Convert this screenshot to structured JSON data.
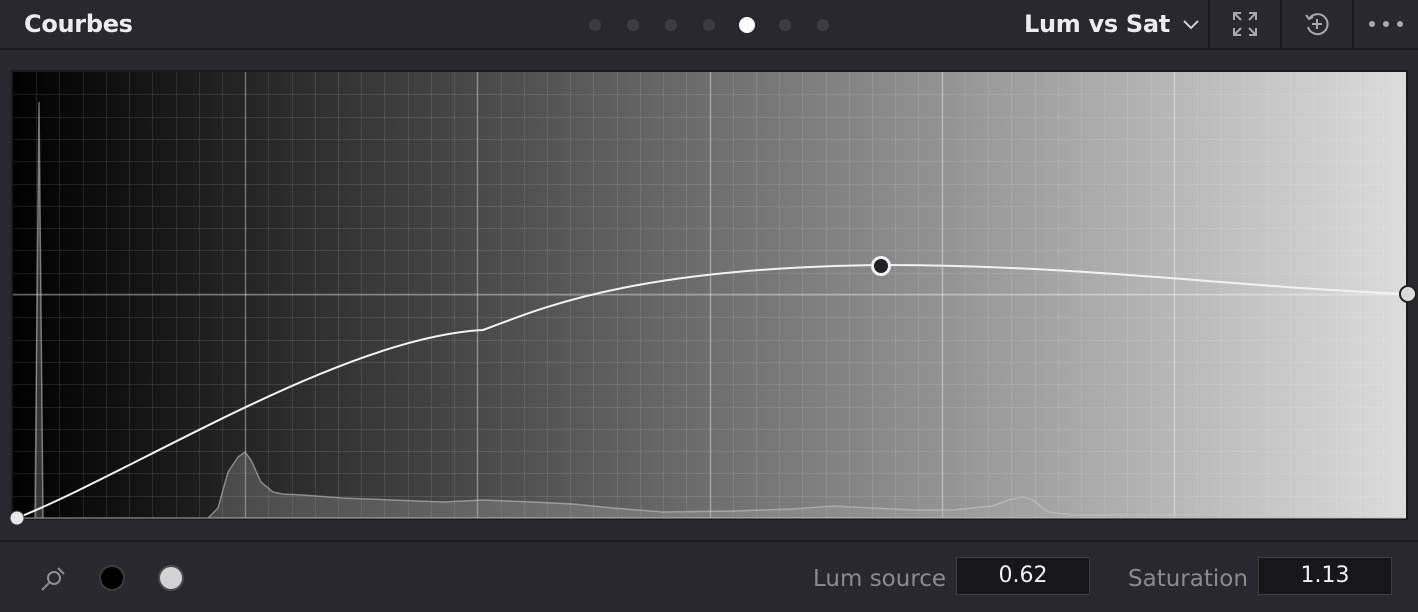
{
  "header": {
    "title": "Courbes",
    "mode": "Lum vs Sat",
    "page_count": 7,
    "active_page": 5
  },
  "footer": {
    "lum_source_label": "Lum source",
    "lum_source_value": "0.62",
    "saturation_label": "Saturation",
    "saturation_value": "1.13"
  },
  "curve": {
    "control_points": [
      {
        "lum": 0.0,
        "sat": 0.0
      },
      {
        "lum": 0.62,
        "sat": 1.13
      },
      {
        "lum": 1.0,
        "sat": 1.0
      }
    ],
    "selected_point": 1
  },
  "icons": {
    "expand": "expand-icon",
    "reset": "reset-icon",
    "more": "more-options-icon",
    "picker": "eyedropper-icon",
    "black_swatch": "black-point-icon",
    "white_swatch": "white-point-icon"
  },
  "colors": {
    "panel": "#28282e",
    "curve": "#f2f2f2",
    "selected_point": "#222226"
  }
}
